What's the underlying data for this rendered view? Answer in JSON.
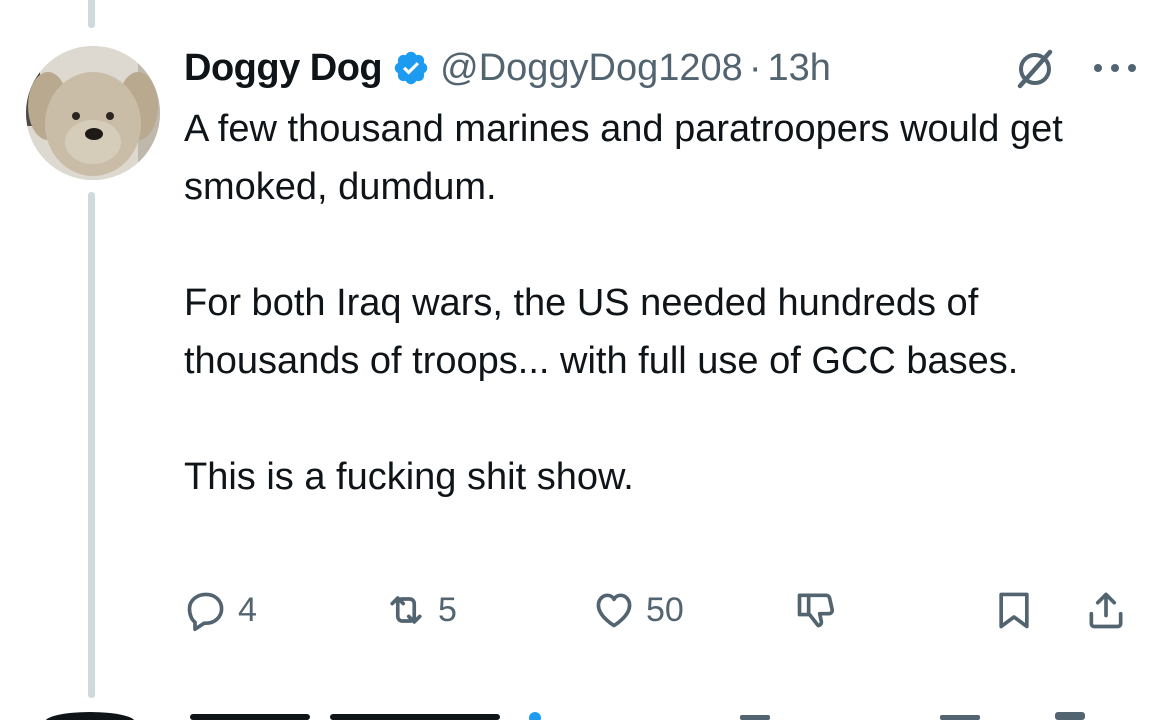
{
  "tweet": {
    "display_name": "Doggy Dog",
    "handle": "@DoggyDog1208",
    "separator": "·",
    "time": "13h",
    "paragraphs": [
      "A few thousand marines and paratroopers would get smoked, dumdum.",
      "For both Iraq wars, the US needed hundreds of thousands of troops... with full use of GCC bases.",
      "This is a fucking shit show."
    ]
  },
  "actions": {
    "replies": "4",
    "reposts": "5",
    "likes": "50"
  },
  "icons": {
    "verified": "verified-badge-icon",
    "grok": "grok-icon",
    "more": "more-icon",
    "reply": "reply-icon",
    "repost": "repost-icon",
    "like": "heart-icon",
    "dislike": "thumbs-down-icon",
    "bookmark": "bookmark-icon",
    "share": "share-icon"
  },
  "colors": {
    "verified": "#1d9bf0",
    "secondary_text": "#536471",
    "primary_text": "#0f1419",
    "thread_line": "#cfd9de"
  }
}
